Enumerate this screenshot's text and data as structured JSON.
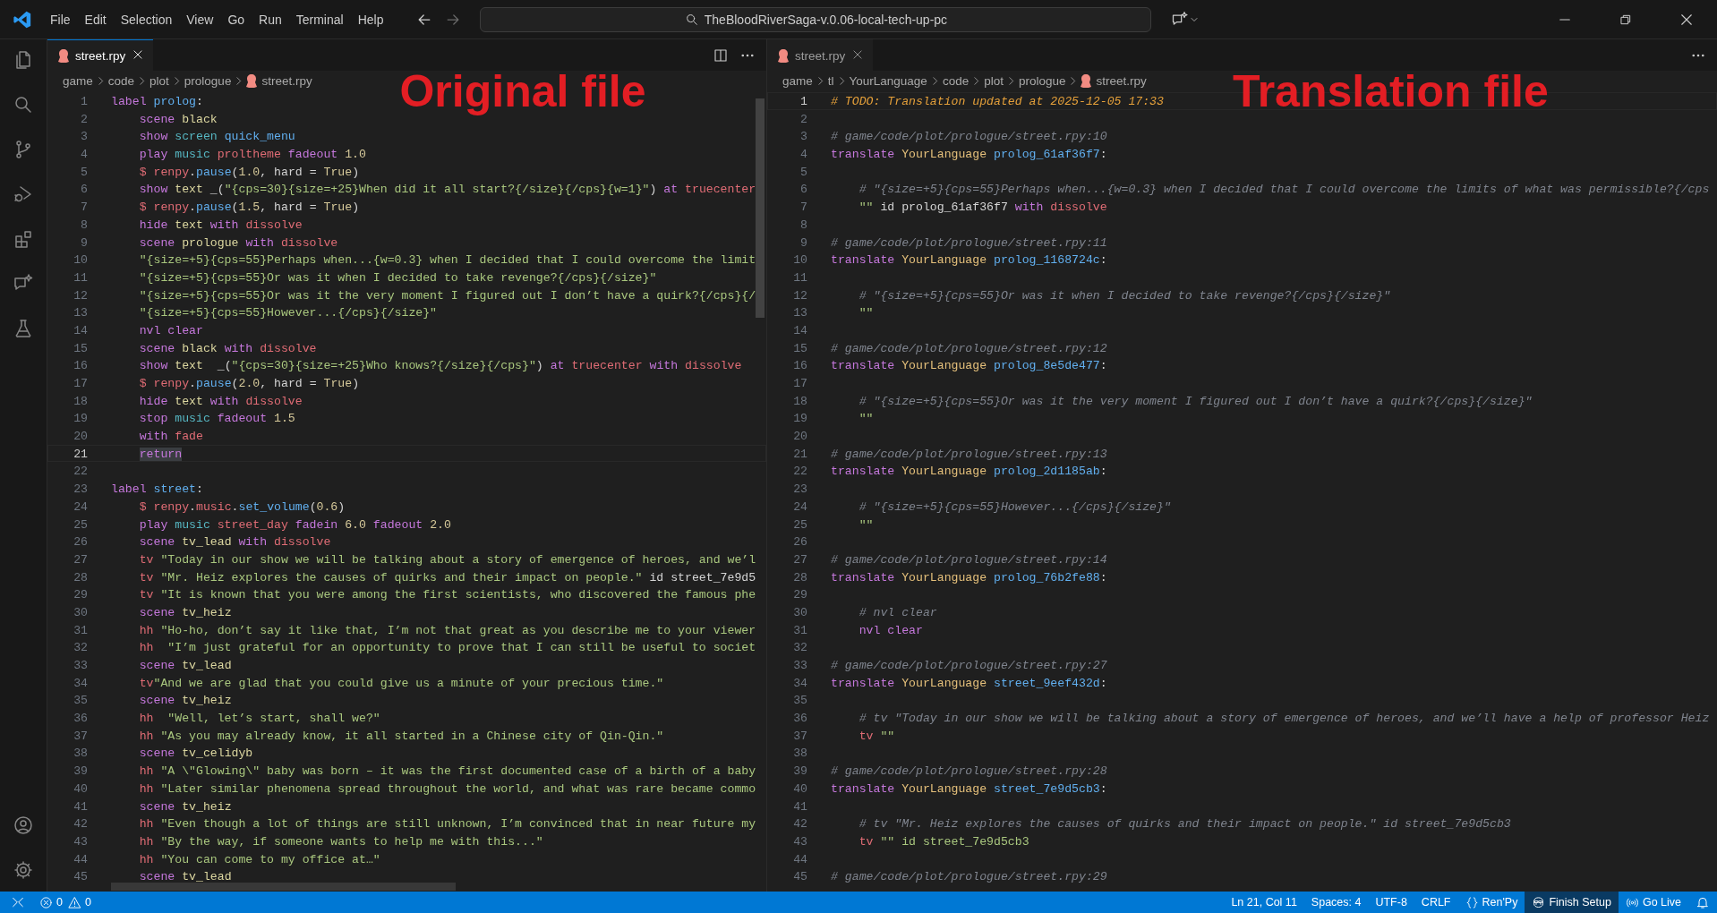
{
  "title_bar": {
    "menu": [
      "File",
      "Edit",
      "Selection",
      "View",
      "Go",
      "Run",
      "Terminal",
      "Help"
    ],
    "search": "TheBloodRiverSaga-v.0.06-local-tech-up-pc"
  },
  "activity_bar": {
    "top": [
      {
        "kind": "files"
      },
      {
        "kind": "search"
      },
      {
        "kind": "branch"
      },
      {
        "kind": "debug"
      },
      {
        "kind": "extensions"
      },
      {
        "kind": "chat"
      },
      {
        "kind": "flask"
      }
    ],
    "bottom": [
      {
        "kind": "account"
      },
      {
        "kind": "gear"
      }
    ]
  },
  "editors": [
    {
      "tab": {
        "label": "street.rpy",
        "selected": true
      },
      "actions": [
        {
          "kind": "split"
        },
        {
          "kind": "more"
        }
      ],
      "breadcrumbs": [
        {
          "kind": "folder",
          "text": "game"
        },
        {
          "kind": "folder",
          "text": "code"
        },
        {
          "kind": "folder",
          "text": "plot"
        },
        {
          "kind": "folder",
          "text": "prologue"
        },
        {
          "kind": "file",
          "text": "street.rpy"
        }
      ],
      "overlay_label": "Original file",
      "lines": [
        {
          "number": "1",
          "current": false,
          "tokens": [
            {
              "kind": "kw",
              "text": "label"
            },
            {
              "kind": "nm",
              "text": " prolog"
            },
            {
              "kind": "pl",
              "text": ":"
            }
          ]
        },
        {
          "number": "2",
          "current": false,
          "tokens": [
            {
              "kind": "kw",
              "text": "    scene"
            },
            {
              "kind": "im",
              "text": " black"
            }
          ]
        },
        {
          "number": "3",
          "current": false,
          "tokens": [
            {
              "kind": "kw",
              "text": "    show"
            },
            {
              "kind": "fn",
              "text": " screen"
            },
            {
              "kind": "nm",
              "text": " quick_menu"
            }
          ]
        },
        {
          "number": "4",
          "current": false,
          "tokens": [
            {
              "kind": "kw",
              "text": "    play"
            },
            {
              "kind": "fn",
              "text": " music"
            },
            {
              "kind": "tr",
              "text": " proltheme"
            },
            {
              "kind": "kw",
              "text": " fadeout"
            },
            {
              "kind": "nu",
              "text": " 1.0"
            }
          ]
        },
        {
          "number": "5",
          "current": false,
          "tokens": [
            {
              "kind": "tr",
              "text": "    $ renpy"
            },
            {
              "kind": "pl",
              "text": "."
            },
            {
              "kind": "nm",
              "text": "pause"
            },
            {
              "kind": "pl",
              "text": "("
            },
            {
              "kind": "nu",
              "text": "1.0"
            },
            {
              "kind": "pl",
              "text": ", hard = "
            },
            {
              "kind": "nu",
              "text": "True"
            },
            {
              "kind": "pl",
              "text": ")"
            }
          ]
        },
        {
          "number": "6",
          "current": false,
          "tokens": [
            {
              "kind": "kw",
              "text": "    show"
            },
            {
              "kind": "im",
              "text": " text"
            },
            {
              "kind": "pl",
              "text": " _("
            },
            {
              "kind": "st",
              "text": "\"{cps=30}{size=+25}When did it all start?{/size}{/cps}{w=1}\""
            },
            {
              "kind": "pl",
              "text": ")"
            },
            {
              "kind": "kw",
              "text": " at"
            },
            {
              "kind": "tr",
              "text": " truecenter"
            }
          ]
        },
        {
          "number": "7",
          "current": false,
          "tokens": [
            {
              "kind": "tr",
              "text": "    $ renpy"
            },
            {
              "kind": "pl",
              "text": "."
            },
            {
              "kind": "nm",
              "text": "pause"
            },
            {
              "kind": "pl",
              "text": "("
            },
            {
              "kind": "nu",
              "text": "1.5"
            },
            {
              "kind": "pl",
              "text": ", hard = "
            },
            {
              "kind": "nu",
              "text": "True"
            },
            {
              "kind": "pl",
              "text": ")"
            }
          ]
        },
        {
          "number": "8",
          "current": false,
          "tokens": [
            {
              "kind": "kw",
              "text": "    hide"
            },
            {
              "kind": "im",
              "text": " text"
            },
            {
              "kind": "kw",
              "text": " with"
            },
            {
              "kind": "tr",
              "text": " dissolve"
            }
          ]
        },
        {
          "number": "9",
          "current": false,
          "tokens": [
            {
              "kind": "kw",
              "text": "    scene"
            },
            {
              "kind": "im",
              "text": " prologue"
            },
            {
              "kind": "kw",
              "text": " with"
            },
            {
              "kind": "tr",
              "text": " dissolve"
            }
          ]
        },
        {
          "number": "10",
          "current": false,
          "tokens": [
            {
              "kind": "st",
              "text": "    \"{size=+5}{cps=55}Perhaps when...{w=0.3} when I decided that I could overcome the limit"
            }
          ]
        },
        {
          "number": "11",
          "current": false,
          "tokens": [
            {
              "kind": "st",
              "text": "    \"{size=+5}{cps=55}Or was it when I decided to take revenge?{/cps}{/size}\""
            }
          ]
        },
        {
          "number": "12",
          "current": false,
          "tokens": [
            {
              "kind": "st",
              "text": "    \"{size=+5}{cps=55}Or was it the very moment I figured out I don’t have a quirk?{/cps}{/"
            }
          ]
        },
        {
          "number": "13",
          "current": false,
          "tokens": [
            {
              "kind": "st",
              "text": "    \"{size=+5}{cps=55}However...{/cps}{/size}\""
            }
          ]
        },
        {
          "number": "14",
          "current": false,
          "tokens": [
            {
              "kind": "kw",
              "text": "    nvl"
            },
            {
              "kind": "kw",
              "text": " clear"
            }
          ]
        },
        {
          "number": "15",
          "current": false,
          "tokens": [
            {
              "kind": "kw",
              "text": "    scene"
            },
            {
              "kind": "im",
              "text": " black"
            },
            {
              "kind": "kw",
              "text": " with"
            },
            {
              "kind": "tr",
              "text": " dissolve"
            }
          ]
        },
        {
          "number": "16",
          "current": false,
          "tokens": [
            {
              "kind": "kw",
              "text": "    show"
            },
            {
              "kind": "im",
              "text": " text"
            },
            {
              "kind": "pl",
              "text": "  _("
            },
            {
              "kind": "st",
              "text": "\"{cps=30}{size=+25}Who knows?{/size}{/cps}\""
            },
            {
              "kind": "pl",
              "text": ")"
            },
            {
              "kind": "kw",
              "text": " at"
            },
            {
              "kind": "tr",
              "text": " truecenter"
            },
            {
              "kind": "kw",
              "text": " with"
            },
            {
              "kind": "tr",
              "text": " dissolve"
            }
          ]
        },
        {
          "number": "17",
          "current": false,
          "tokens": [
            {
              "kind": "tr",
              "text": "    $ renpy"
            },
            {
              "kind": "pl",
              "text": "."
            },
            {
              "kind": "nm",
              "text": "pause"
            },
            {
              "kind": "pl",
              "text": "("
            },
            {
              "kind": "nu",
              "text": "2.0"
            },
            {
              "kind": "pl",
              "text": ", hard = "
            },
            {
              "kind": "nu",
              "text": "True"
            },
            {
              "kind": "pl",
              "text": ")"
            }
          ]
        },
        {
          "number": "18",
          "current": false,
          "tokens": [
            {
              "kind": "kw",
              "text": "    hide"
            },
            {
              "kind": "im",
              "text": " text"
            },
            {
              "kind": "kw",
              "text": " with"
            },
            {
              "kind": "tr",
              "text": " dissolve"
            }
          ]
        },
        {
          "number": "19",
          "current": false,
          "tokens": [
            {
              "kind": "kw",
              "text": "    stop"
            },
            {
              "kind": "fn",
              "text": " music"
            },
            {
              "kind": "kw",
              "text": " fadeout"
            },
            {
              "kind": "nu",
              "text": " 1.5"
            }
          ]
        },
        {
          "number": "20",
          "current": false,
          "tokens": [
            {
              "kind": "kw",
              "text": "    with"
            },
            {
              "kind": "tr",
              "text": " fade"
            }
          ]
        },
        {
          "number": "21",
          "current": true,
          "tokens": [
            {
              "kind": "selection",
              "text": "    return"
            }
          ]
        },
        {
          "number": "22",
          "current": false
        },
        {
          "number": "23",
          "current": false,
          "tokens": [
            {
              "kind": "kw",
              "text": "label"
            },
            {
              "kind": "nm",
              "text": " street"
            },
            {
              "kind": "pl",
              "text": ":"
            }
          ]
        },
        {
          "number": "24",
          "current": false,
          "tokens": [
            {
              "kind": "tr",
              "text": "    $ renpy"
            },
            {
              "kind": "pl",
              "text": "."
            },
            {
              "kind": "tr",
              "text": "music"
            },
            {
              "kind": "pl",
              "text": "."
            },
            {
              "kind": "nm",
              "text": "set_volume"
            },
            {
              "kind": "pl",
              "text": "("
            },
            {
              "kind": "nu",
              "text": "0.6"
            },
            {
              "kind": "pl",
              "text": ")"
            }
          ]
        },
        {
          "number": "25",
          "current": false,
          "tokens": [
            {
              "kind": "kw",
              "text": "    play"
            },
            {
              "kind": "fn",
              "text": " music"
            },
            {
              "kind": "tr",
              "text": " street_day"
            },
            {
              "kind": "kw",
              "text": " fadein"
            },
            {
              "kind": "nu",
              "text": " 6.0"
            },
            {
              "kind": "kw",
              "text": " fadeout"
            },
            {
              "kind": "nu",
              "text": " 2.0"
            }
          ]
        },
        {
          "number": "26",
          "current": false,
          "tokens": [
            {
              "kind": "kw",
              "text": "    scene"
            },
            {
              "kind": "im",
              "text": " tv_lead"
            },
            {
              "kind": "kw",
              "text": " with"
            },
            {
              "kind": "tr",
              "text": " dissolve"
            }
          ]
        },
        {
          "number": "27",
          "current": false,
          "tokens": [
            {
              "kind": "ch",
              "text": "    tv"
            },
            {
              "kind": "st",
              "text": " \"Today in our show we will be talking about a story of emergence of heroes, and we’l"
            }
          ]
        },
        {
          "number": "28",
          "current": false,
          "tokens": [
            {
              "kind": "ch",
              "text": "    tv"
            },
            {
              "kind": "st",
              "text": " \"Mr. Heiz explores the causes of quirks and their impact on people.\""
            },
            {
              "kind": "pl",
              "text": " id street_7e9d5"
            }
          ]
        },
        {
          "number": "29",
          "current": false,
          "tokens": [
            {
              "kind": "ch",
              "text": "    tv"
            },
            {
              "kind": "st",
              "text": " \"It is known that you were among the first scientists, who discovered the famous phe"
            }
          ]
        },
        {
          "number": "30",
          "current": false,
          "tokens": [
            {
              "kind": "kw",
              "text": "    scene"
            },
            {
              "kind": "im",
              "text": " tv_heiz"
            }
          ]
        },
        {
          "number": "31",
          "current": false,
          "tokens": [
            {
              "kind": "ch",
              "text": "    hh"
            },
            {
              "kind": "st",
              "text": " \"Ho-ho, don’t say it like that, I’m not that great as you describe me to your viewer"
            }
          ]
        },
        {
          "number": "32",
          "current": false,
          "tokens": [
            {
              "kind": "ch",
              "text": "    hh"
            },
            {
              "kind": "st",
              "text": "  \"I’m just grateful for an opportunity to prove that I can still be useful to societ"
            }
          ]
        },
        {
          "number": "33",
          "current": false,
          "tokens": [
            {
              "kind": "kw",
              "text": "    scene"
            },
            {
              "kind": "im",
              "text": " tv_lead"
            }
          ]
        },
        {
          "number": "34",
          "current": false,
          "tokens": [
            {
              "kind": "ch",
              "text": "    tv"
            },
            {
              "kind": "st",
              "text": "\"And we are glad that you could give us a minute of your precious time.\""
            }
          ]
        },
        {
          "number": "35",
          "current": false,
          "tokens": [
            {
              "kind": "kw",
              "text": "    scene"
            },
            {
              "kind": "im",
              "text": " tv_heiz"
            }
          ]
        },
        {
          "number": "36",
          "current": false,
          "tokens": [
            {
              "kind": "ch",
              "text": "    hh"
            },
            {
              "kind": "st",
              "text": "  \"Well, let’s start, shall we?\""
            }
          ]
        },
        {
          "number": "37",
          "current": false,
          "tokens": [
            {
              "kind": "ch",
              "text": "    hh"
            },
            {
              "kind": "st",
              "text": " \"As you may already know, it all started in a Chinese city of Qin-Qin.\""
            }
          ]
        },
        {
          "number": "38",
          "current": false,
          "tokens": [
            {
              "kind": "kw",
              "text": "    scene"
            },
            {
              "kind": "im",
              "text": " tv_celidyb"
            }
          ]
        },
        {
          "number": "39",
          "current": false,
          "tokens": [
            {
              "kind": "ch",
              "text": "    hh"
            },
            {
              "kind": "st",
              "text": " \"A \\\"Glowing\\\" baby was born – it was the first documented case of a birth of a baby"
            }
          ]
        },
        {
          "number": "40",
          "current": false,
          "tokens": [
            {
              "kind": "ch",
              "text": "    hh"
            },
            {
              "kind": "st",
              "text": " \"Later similar phenomena spread throughout the world, and what was rare became commo"
            }
          ]
        },
        {
          "number": "41",
          "current": false,
          "tokens": [
            {
              "kind": "kw",
              "text": "    scene"
            },
            {
              "kind": "im",
              "text": " tv_heiz"
            }
          ]
        },
        {
          "number": "42",
          "current": false,
          "tokens": [
            {
              "kind": "ch",
              "text": "    hh"
            },
            {
              "kind": "st",
              "text": " \"Even though a lot of things are still unknown, I’m convinced that in near future my"
            }
          ]
        },
        {
          "number": "43",
          "current": false,
          "tokens": [
            {
              "kind": "ch",
              "text": "    hh"
            },
            {
              "kind": "st",
              "text": " \"By the way, if someone wants to help me with this...\""
            }
          ]
        },
        {
          "number": "44",
          "current": false,
          "tokens": [
            {
              "kind": "ch",
              "text": "    hh"
            },
            {
              "kind": "st",
              "text": " \"You can come to my office at…\""
            }
          ]
        },
        {
          "number": "45",
          "current": false,
          "tokens": [
            {
              "kind": "kw",
              "text": "    scene"
            },
            {
              "kind": "im",
              "text": " tv_lead"
            }
          ]
        }
      ]
    },
    {
      "tab": {
        "label": "street.rpy",
        "selected": false
      },
      "actions": [
        {
          "kind": "more"
        }
      ],
      "breadcrumbs": [
        {
          "kind": "folder",
          "text": "game"
        },
        {
          "kind": "folder",
          "text": "tl"
        },
        {
          "kind": "folder",
          "text": "YourLanguage"
        },
        {
          "kind": "folder",
          "text": "code"
        },
        {
          "kind": "folder",
          "text": "plot"
        },
        {
          "kind": "folder",
          "text": "prologue"
        },
        {
          "kind": "file",
          "text": "street.rpy"
        }
      ],
      "overlay_label": "Translation file",
      "lines": [
        {
          "number": "1",
          "current": true,
          "tokens": [
            {
              "kind": "todo",
              "text": "# TODO: Translation updated at 2025-12-05 17:33"
            }
          ]
        },
        {
          "number": "2",
          "current": false
        },
        {
          "number": "3",
          "current": false,
          "tokens": [
            {
              "kind": "cm",
              "text": "# game/code/plot/prologue/street.rpy:10"
            }
          ]
        },
        {
          "number": "4",
          "current": false,
          "tokens": [
            {
              "kind": "kw",
              "text": "translate"
            },
            {
              "kind": "ln",
              "text": " YourLanguage"
            },
            {
              "kind": "nm",
              "text": " prolog_61af36f7"
            },
            {
              "kind": "pl",
              "text": ":"
            }
          ]
        },
        {
          "number": "5",
          "current": false
        },
        {
          "number": "6",
          "current": false,
          "tokens": [
            {
              "kind": "cm",
              "text": "    # \"{size=+5}{cps=55}Perhaps when...{w=0.3} when I decided that I could overcome the limits of what was permissible?{/cps"
            }
          ]
        },
        {
          "number": "7",
          "current": false,
          "tokens": [
            {
              "kind": "st",
              "text": "    \"\""
            },
            {
              "kind": "pl",
              "text": " id prolog_61af36f7"
            },
            {
              "kind": "kw",
              "text": " with"
            },
            {
              "kind": "tr",
              "text": " dissolve"
            }
          ]
        },
        {
          "number": "8",
          "current": false
        },
        {
          "number": "9",
          "current": false,
          "tokens": [
            {
              "kind": "cm",
              "text": "# game/code/plot/prologue/street.rpy:11"
            }
          ]
        },
        {
          "number": "10",
          "current": false,
          "tokens": [
            {
              "kind": "kw",
              "text": "translate"
            },
            {
              "kind": "ln",
              "text": " YourLanguage"
            },
            {
              "kind": "nm",
              "text": " prolog_1168724c"
            },
            {
              "kind": "pl",
              "text": ":"
            }
          ]
        },
        {
          "number": "11",
          "current": false
        },
        {
          "number": "12",
          "current": false,
          "tokens": [
            {
              "kind": "cm",
              "text": "    # \"{size=+5}{cps=55}Or was it when I decided to take revenge?{/cps}{/size}\""
            }
          ]
        },
        {
          "number": "13",
          "current": false,
          "tokens": [
            {
              "kind": "st",
              "text": "    \"\""
            }
          ]
        },
        {
          "number": "14",
          "current": false
        },
        {
          "number": "15",
          "current": false,
          "tokens": [
            {
              "kind": "cm",
              "text": "# game/code/plot/prologue/street.rpy:12"
            }
          ]
        },
        {
          "number": "16",
          "current": false,
          "tokens": [
            {
              "kind": "kw",
              "text": "translate"
            },
            {
              "kind": "ln",
              "text": " YourLanguage"
            },
            {
              "kind": "nm",
              "text": " prolog_8e5de477"
            },
            {
              "kind": "pl",
              "text": ":"
            }
          ]
        },
        {
          "number": "17",
          "current": false
        },
        {
          "number": "18",
          "current": false,
          "tokens": [
            {
              "kind": "cm",
              "text": "    # \"{size=+5}{cps=55}Or was it the very moment I figured out I don’t have a quirk?{/cps}{/size}\""
            }
          ]
        },
        {
          "number": "19",
          "current": false,
          "tokens": [
            {
              "kind": "st",
              "text": "    \"\""
            }
          ]
        },
        {
          "number": "20",
          "current": false
        },
        {
          "number": "21",
          "current": false,
          "tokens": [
            {
              "kind": "cm",
              "text": "# game/code/plot/prologue/street.rpy:13"
            }
          ]
        },
        {
          "number": "22",
          "current": false,
          "tokens": [
            {
              "kind": "kw",
              "text": "translate"
            },
            {
              "kind": "ln",
              "text": " YourLanguage"
            },
            {
              "kind": "nm",
              "text": " prolog_2d1185ab"
            },
            {
              "kind": "pl",
              "text": ":"
            }
          ]
        },
        {
          "number": "23",
          "current": false
        },
        {
          "number": "24",
          "current": false,
          "tokens": [
            {
              "kind": "cm",
              "text": "    # \"{size=+5}{cps=55}However...{/cps}{/size}\""
            }
          ]
        },
        {
          "number": "25",
          "current": false,
          "tokens": [
            {
              "kind": "st",
              "text": "    \"\""
            }
          ]
        },
        {
          "number": "26",
          "current": false
        },
        {
          "number": "27",
          "current": false,
          "tokens": [
            {
              "kind": "cm",
              "text": "# game/code/plot/prologue/street.rpy:14"
            }
          ]
        },
        {
          "number": "28",
          "current": false,
          "tokens": [
            {
              "kind": "kw",
              "text": "translate"
            },
            {
              "kind": "ln",
              "text": " YourLanguage"
            },
            {
              "kind": "nm",
              "text": " prolog_76b2fe88"
            },
            {
              "kind": "pl",
              "text": ":"
            }
          ]
        },
        {
          "number": "29",
          "current": false
        },
        {
          "number": "30",
          "current": false,
          "tokens": [
            {
              "kind": "cm",
              "text": "    # nvl clear"
            }
          ]
        },
        {
          "number": "31",
          "current": false,
          "tokens": [
            {
              "kind": "kw",
              "text": "    nvl"
            },
            {
              "kind": "kw",
              "text": " clear"
            }
          ]
        },
        {
          "number": "32",
          "current": false
        },
        {
          "number": "33",
          "current": false,
          "tokens": [
            {
              "kind": "cm",
              "text": "# game/code/plot/prologue/street.rpy:27"
            }
          ]
        },
        {
          "number": "34",
          "current": false,
          "tokens": [
            {
              "kind": "kw",
              "text": "translate"
            },
            {
              "kind": "ln",
              "text": " YourLanguage"
            },
            {
              "kind": "nm",
              "text": " street_9eef432d"
            },
            {
              "kind": "pl",
              "text": ":"
            }
          ]
        },
        {
          "number": "35",
          "current": false
        },
        {
          "number": "36",
          "current": false,
          "tokens": [
            {
              "kind": "cm",
              "text": "    # tv \"Today in our show we will be talking about a story of emergence of heroes, and we’ll have a help of professor Heiz"
            }
          ]
        },
        {
          "number": "37",
          "current": false,
          "tokens": [
            {
              "kind": "ch",
              "text": "    tv"
            },
            {
              "kind": "st",
              "text": " \"\""
            }
          ]
        },
        {
          "number": "38",
          "current": false
        },
        {
          "number": "39",
          "current": false,
          "tokens": [
            {
              "kind": "cm",
              "text": "# game/code/plot/prologue/street.rpy:28"
            }
          ]
        },
        {
          "number": "40",
          "current": false,
          "tokens": [
            {
              "kind": "kw",
              "text": "translate"
            },
            {
              "kind": "ln",
              "text": " YourLanguage"
            },
            {
              "kind": "nm",
              "text": " street_7e9d5cb3"
            },
            {
              "kind": "pl",
              "text": ":"
            }
          ]
        },
        {
          "number": "41",
          "current": false
        },
        {
          "number": "42",
          "current": false,
          "tokens": [
            {
              "kind": "cm",
              "text": "    # tv \"Mr. Heiz explores the causes of quirks and their impact on people.\" id street_7e9d5cb3"
            }
          ]
        },
        {
          "number": "43",
          "current": false,
          "tokens": [
            {
              "kind": "ch",
              "text": "    tv"
            },
            {
              "kind": "st",
              "text": " \"\" id street_7e9d5cb3"
            }
          ]
        },
        {
          "number": "44",
          "current": false
        },
        {
          "number": "45",
          "current": false,
          "tokens": [
            {
              "kind": "cm",
              "text": "# game/code/plot/prologue/street.rpy:29"
            }
          ]
        }
      ]
    }
  ],
  "status_bar": {
    "left": [
      {
        "kind": "remote"
      },
      {
        "kind": "errors",
        "text": "0"
      },
      {
        "kind": "warnings",
        "text": "0"
      }
    ],
    "right": [
      {
        "kind": "text",
        "text": "Ln 21, Col 11"
      },
      {
        "kind": "text",
        "text": "Spaces: 4"
      },
      {
        "kind": "text",
        "text": "UTF-8"
      },
      {
        "kind": "text",
        "text": "CRLF"
      },
      {
        "kind": "language",
        "text": "Ren'Py"
      },
      {
        "kind": "setup",
        "text": "Finish Setup"
      },
      {
        "kind": "live",
        "text": "Go Live"
      },
      {
        "kind": "bell"
      }
    ]
  }
}
